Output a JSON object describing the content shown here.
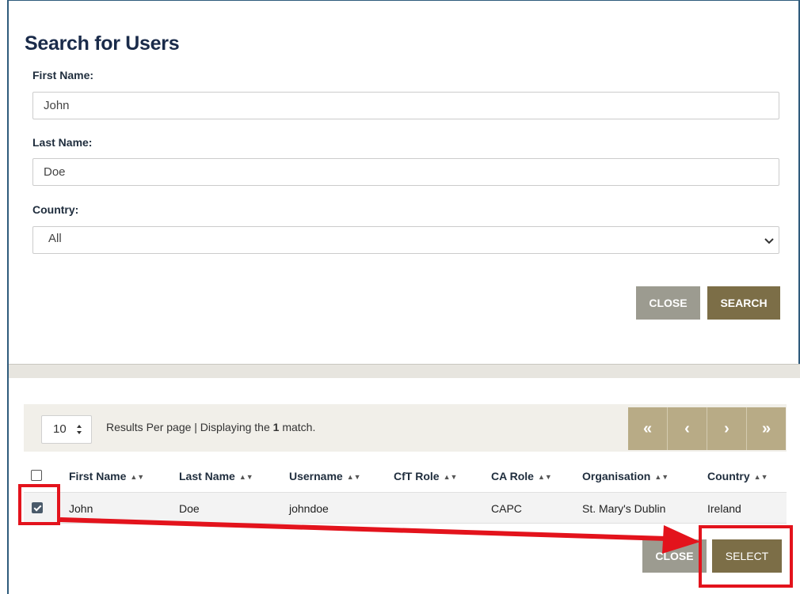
{
  "dialog": {
    "title": "Search for Users",
    "first_name_label": "First Name:",
    "first_name_value": "John",
    "last_name_label": "Last Name:",
    "last_name_value": "Doe",
    "country_label": "Country:",
    "country_value": "All",
    "close_label": "CLOSE",
    "search_label": "SEARCH"
  },
  "results": {
    "per_page": "10",
    "summary_prefix": "Results Per page | Displaying the ",
    "match_count": "1",
    "summary_suffix": " match.",
    "pager": [
      "«",
      "‹",
      "›",
      "»"
    ],
    "columns": [
      "First Name",
      "Last Name",
      "Username",
      "CfT Role",
      "CA Role",
      "Organisation",
      "Country"
    ],
    "rows": [
      {
        "selected": true,
        "first_name": "John",
        "last_name": "Doe",
        "username": "johndoe",
        "cft_role": "",
        "ca_role": "CAPC",
        "organisation": "St. Mary's Dublin",
        "country": "Ireland"
      }
    ],
    "close_label": "CLOSE",
    "select_label": "SELECT"
  },
  "colors": {
    "primary_button": "#7c6e47",
    "close_button": "#9c9b90",
    "pager": "#b8ab86",
    "annotation": "#e3131c"
  }
}
